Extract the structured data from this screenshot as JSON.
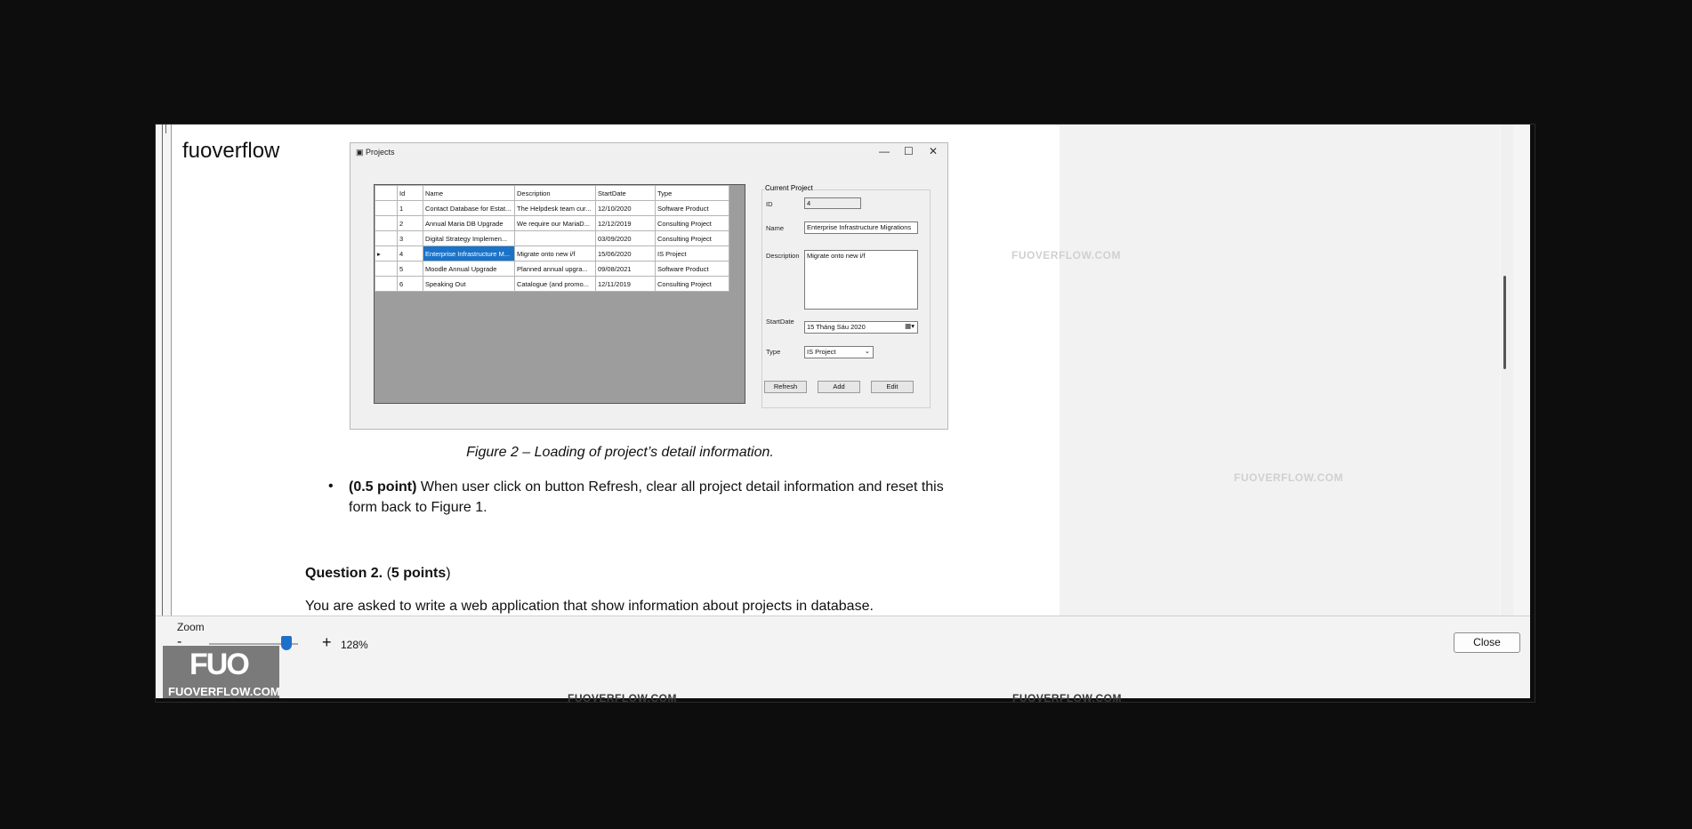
{
  "site_logo_text": "fuoverflow",
  "screenshot": {
    "window_title": "Projects",
    "window_controls": {
      "minimize": "—",
      "maximize": "☐",
      "close": "✕"
    },
    "grid": {
      "columns": [
        "Id",
        "Name",
        "Description",
        "StartDate",
        "Type"
      ],
      "rows": [
        {
          "marker": "",
          "id": "1",
          "name": "Contact Database for Estat...",
          "description": "The Helpdesk team cur...",
          "start": "12/10/2020",
          "type": "Software Product"
        },
        {
          "marker": "",
          "id": "2",
          "name": "Annual Maria DB Upgrade",
          "description": "We require our MariaD...",
          "start": "12/12/2019",
          "type": "Consulting Project"
        },
        {
          "marker": "",
          "id": "3",
          "name": "Digital Strategy Implemen...",
          "description": "",
          "start": "03/09/2020",
          "type": "Consulting Project"
        },
        {
          "marker": "▸",
          "id": "4",
          "name": "Enterprise Infrastructure M...",
          "description": "Migrate onto new i/f",
          "start": "15/06/2020",
          "type": "IS Project"
        },
        {
          "marker": "",
          "id": "5",
          "name": "Moodle Annual Upgrade",
          "description": "Planned annual upgra...",
          "start": "09/08/2021",
          "type": "Software Product"
        },
        {
          "marker": "",
          "id": "6",
          "name": "Speaking Out",
          "description": "Catalogue (and promo...",
          "start": "12/11/2019",
          "type": "Consulting Project"
        }
      ]
    },
    "form": {
      "group_title": "Current Project",
      "id_label": "ID",
      "id_value": "4",
      "name_label": "Name",
      "name_value": "Enterprise Infrastructure Migrations",
      "description_label": "Description",
      "description_value": "Migrate onto new i/f",
      "startdate_label": "StartDate",
      "startdate_value": "15    Tháng Sáu    2020",
      "type_label": "Type",
      "type_value": "IS Project",
      "refresh_label": "Refresh",
      "add_label": "Add",
      "edit_label": "Edit"
    }
  },
  "document": {
    "caption": "Figure 2 – Loading of project’s detail information.",
    "bullet_bold": "(0.5 point)",
    "bullet_text": " When user click on button Refresh, clear all project detail information and reset this form back to Figure 1.",
    "question_title": "Question 2.",
    "question_points": "5 points",
    "question_text": "You are asked to write a web application that show information about projects in database."
  },
  "zoom": {
    "label": "Zoom",
    "minus": "-",
    "plus": "+",
    "value": "128%",
    "level_percent": 128
  },
  "close_label": "Close",
  "badge": {
    "mark": "FUO",
    "site": "FUOVERFLOW.COM"
  },
  "watermark": "FUOVERFLOW.COM",
  "colors": {
    "selection": "#1a73c9",
    "slider_thumb": "#1e6fc9"
  }
}
